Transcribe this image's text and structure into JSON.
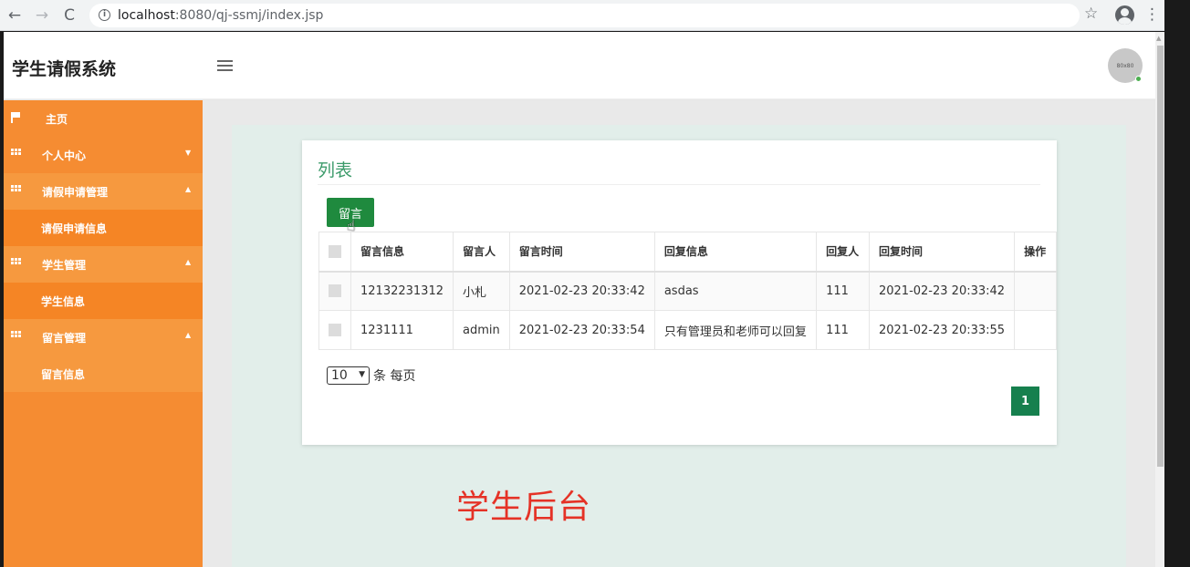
{
  "browser": {
    "url_host": "localhost",
    "url_rest": ":8080/qj-ssmj/index.jsp",
    "back_glyph": "←",
    "forward_glyph": "→",
    "reload_glyph": "C",
    "info_glyph": "i",
    "star_glyph": "☆",
    "menu_glyph": "⋮"
  },
  "header": {
    "title": "学生请假系统",
    "avatar_text": "80x80"
  },
  "sidebar": {
    "items": [
      {
        "label": "主页",
        "icon": "flag-icon"
      },
      {
        "label": "个人中心",
        "icon": "grid-icon",
        "arrow": "▼"
      },
      {
        "label": "请假申请管理",
        "icon": "grid-icon",
        "arrow": "▲"
      },
      {
        "label": "请假申请信息"
      },
      {
        "label": "学生管理",
        "icon": "grid-icon",
        "arrow": "▲"
      },
      {
        "label": "学生信息"
      },
      {
        "label": "留言管理",
        "icon": "grid-icon",
        "arrow": "▲"
      },
      {
        "label": "留言信息"
      }
    ]
  },
  "card": {
    "title": "列表",
    "add_button": "留言"
  },
  "table": {
    "headers": [
      "留言信息",
      "留言人",
      "留言时间",
      "回复信息",
      "回复人",
      "回复时间",
      "操作"
    ],
    "rows": [
      [
        "12132231312",
        "小札",
        "2021-02-23 20:33:42",
        "asdas",
        "111",
        "2021-02-23 20:33:42",
        ""
      ],
      [
        "1231111",
        "admin",
        "2021-02-23 20:33:54",
        "只有管理员和老师可以回复",
        "111",
        "2021-02-23 20:33:55",
        ""
      ]
    ]
  },
  "pagination": {
    "page_size": "10",
    "page_size_suffix": "条 每页",
    "current_page": "1"
  },
  "overlay": {
    "caption": "学生后台"
  },
  "colors": {
    "sidebar": "#f58c32",
    "accent_green": "#1f8a3e",
    "title_green": "#3d9b6b",
    "caption_red": "#e53226"
  }
}
